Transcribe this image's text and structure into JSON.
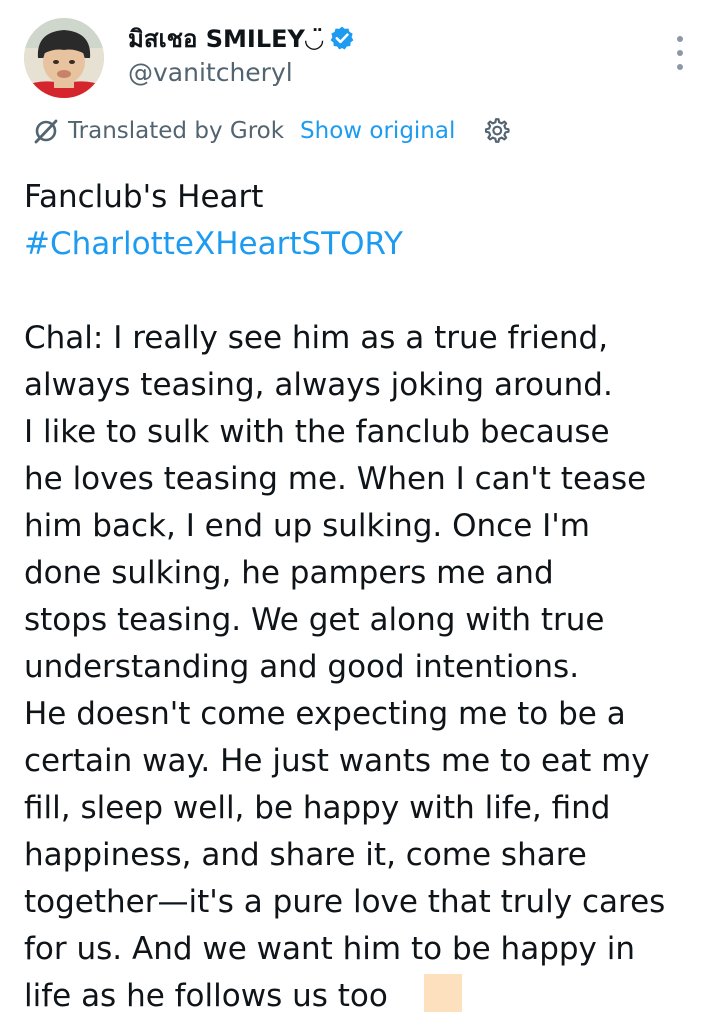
{
  "author": {
    "display_name": "มิสเชอ SMILEY◡̈",
    "handle": "@vanitcheryl",
    "verified": true,
    "verified_color": "#1d9bf0"
  },
  "menu": {
    "icon": "more-vertical-icon"
  },
  "translation": {
    "icon": "grok-icon",
    "label": "Translated by Grok",
    "show_original": "Show original",
    "settings_icon": "gear-icon"
  },
  "tweet": {
    "title": "Fanclub's Heart",
    "hashtag": "#CharlotteXHeartSTORY",
    "lines": [
      "Chal: I really see him as a true friend,",
      "always teasing, always joking around.",
      "I like to sulk with the fanclub because",
      "he loves teasing me. When I can't tease",
      "him back, I end up sulking. Once I'm",
      "done sulking, he pampers me and",
      "stops teasing. We get along with true",
      "understanding and good intentions.",
      "He doesn't come expecting me to be a",
      "certain way. He just wants me to eat my",
      "fill, sleep well, be happy with life, find",
      "happiness, and share it, come share",
      "together—it's a pure love that truly cares",
      "for us. And we want him to be happy in",
      "life as he follows us too"
    ],
    "trailing_emoji": "skin-tone-square-emoji"
  },
  "colors": {
    "link": "#1d9bf0",
    "secondary_text": "#536471",
    "primary_text": "#0f1419"
  }
}
